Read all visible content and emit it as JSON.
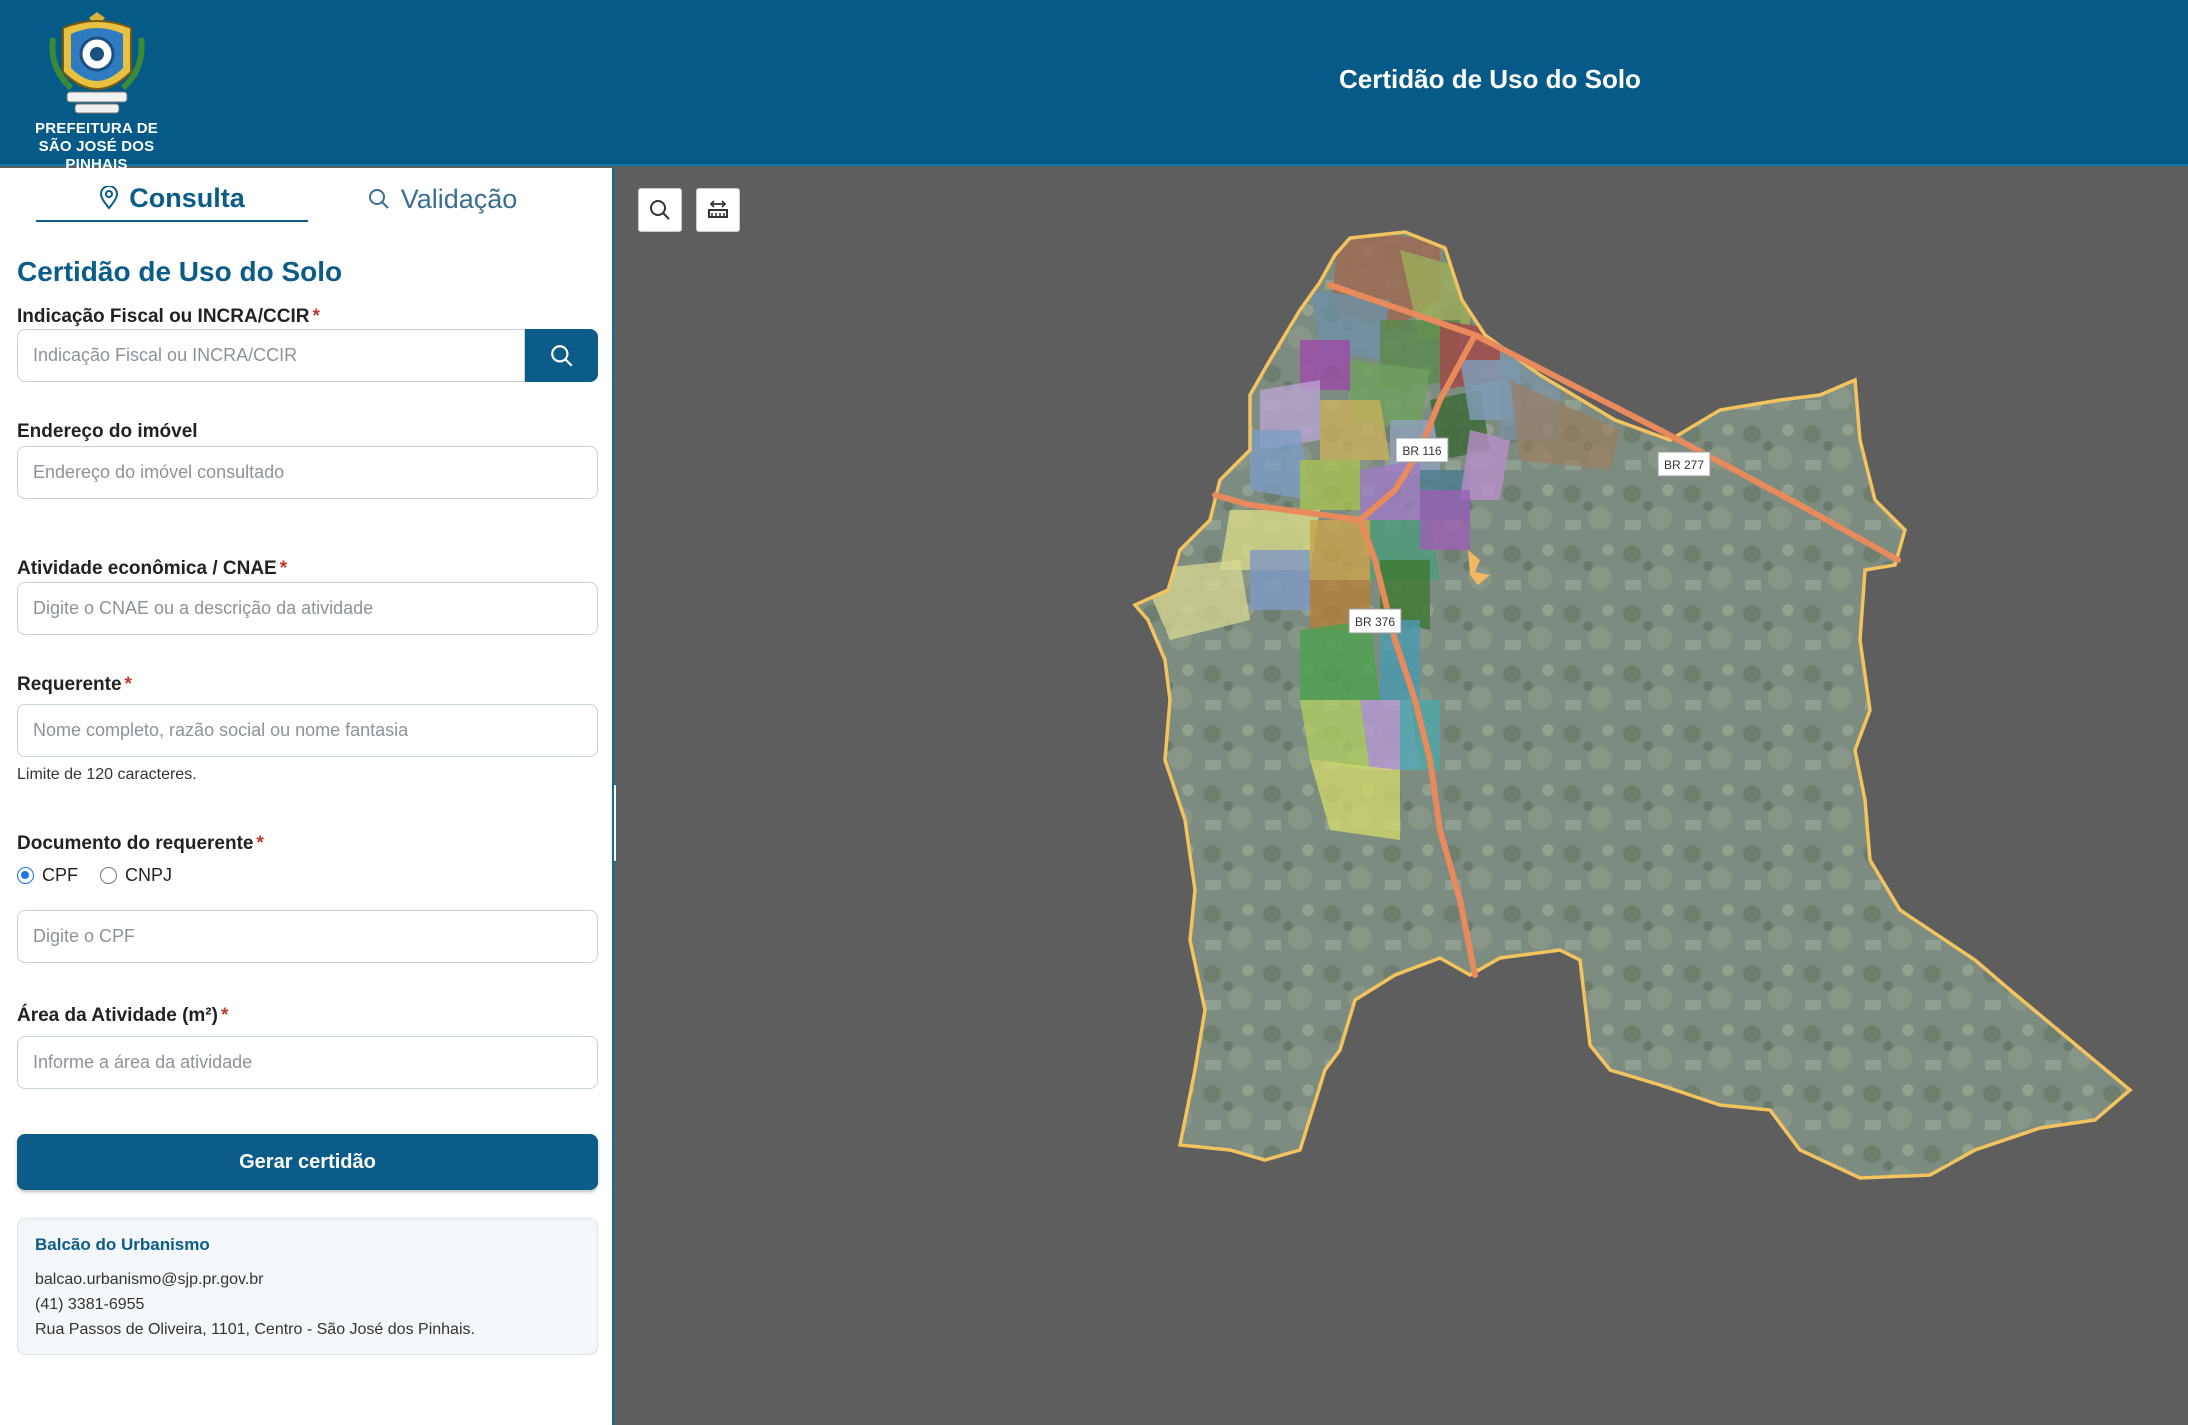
{
  "header": {
    "logo_line1": "PREFEITURA DE",
    "logo_line2": "SÃO JOSÉ DOS PINHAIS",
    "title": "Certidão de Uso do Solo"
  },
  "tabs": [
    {
      "label": "Consulta",
      "icon": "map-pin-icon",
      "active": true
    },
    {
      "label": "Validação",
      "icon": "search-icon",
      "active": false
    }
  ],
  "form": {
    "title": "Certidão de Uso do Solo",
    "fiscal": {
      "label": "Indicação Fiscal ou INCRA/CCIR",
      "placeholder": "Indicação Fiscal ou INCRA/CCIR"
    },
    "address": {
      "label": "Endereço do imóvel",
      "placeholder": "Endereço do imóvel consultado"
    },
    "cnae": {
      "label": "Atividade econômica / CNAE",
      "placeholder": "Digite o CNAE ou a descrição da atividade"
    },
    "requester": {
      "label": "Requerente",
      "placeholder": "Nome completo, razão social ou nome fantasia",
      "helper": "Limite de 120 caracteres."
    },
    "document": {
      "label": "Documento do requerente",
      "options": [
        "CPF",
        "CNPJ"
      ],
      "selected": "CPF",
      "placeholder": "Digite o CPF"
    },
    "area": {
      "label": "Área da Atividade (m²)",
      "placeholder": "Informe a área da atividade"
    },
    "submit_label": "Gerar certidão"
  },
  "info": {
    "title": "Balcão do Urbanismo",
    "email": "balcao.urbanismo@sjp.pr.gov.br",
    "phone": "(41) 3381-6955",
    "address": "Rua Passos de Oliveira, 1101, Centro - São José dos Pinhais."
  },
  "map": {
    "roads": [
      "BR 116",
      "BR 277",
      "BR 376"
    ],
    "colors": {
      "background": "#5e5e5e",
      "boundary": "#f2c35e",
      "road": "#e88a5c",
      "terrain": "#7c8d7f"
    }
  },
  "colors": {
    "primary": "#055a88",
    "accent": "#0b5c88",
    "required": "#c0392b"
  }
}
